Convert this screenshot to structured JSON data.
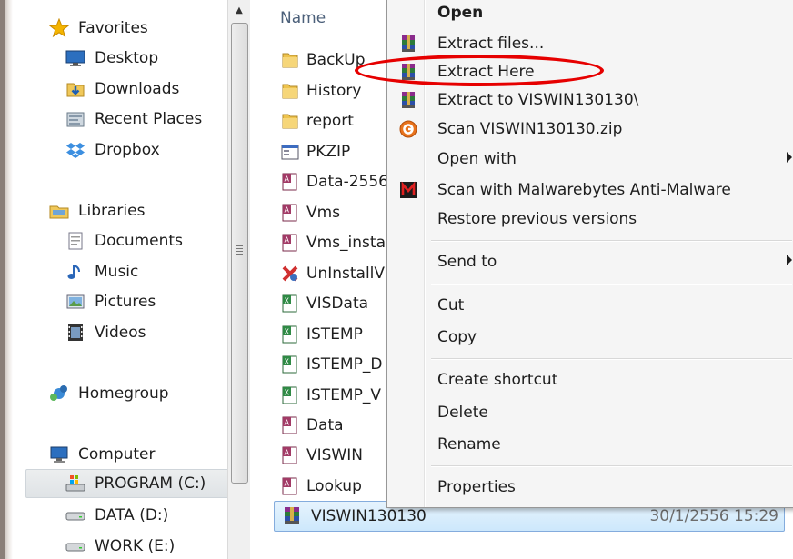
{
  "nav": {
    "favorites": "Favorites",
    "desktop": "Desktop",
    "downloads": "Downloads",
    "recent_places": "Recent Places",
    "dropbox": "Dropbox",
    "libraries": "Libraries",
    "documents": "Documents",
    "music": "Music",
    "pictures": "Pictures",
    "videos": "Videos",
    "homegroup": "Homegroup",
    "computer": "Computer",
    "program_c": "PROGRAM (C:)",
    "data_d": "DATA (D:)",
    "work_e": "WORK (E:)"
  },
  "filelist": {
    "column_name": "Name",
    "rows": [
      "BackUp",
      "History",
      "report",
      "PKZIP",
      "Data-2556",
      "Vms",
      "Vms_insta",
      "UnInstallV",
      "VISData",
      "ISTEMP",
      "ISTEMP_D",
      "ISTEMP_V",
      "Data",
      "VISWIN",
      "Lookup"
    ],
    "selected_name": "VISWIN130130",
    "selected_date": "30/1/2556 15:29"
  },
  "menu": {
    "open": "Open",
    "extract_files": "Extract files...",
    "extract_here": "Extract Here",
    "extract_to": "Extract to VISWIN130130\\",
    "scan_zip": "Scan VISWIN130130.zip",
    "open_with": "Open with",
    "scan_malwarebytes": "Scan with Malwarebytes Anti-Malware",
    "restore_previous": "Restore previous versions",
    "send_to": "Send to",
    "cut": "Cut",
    "copy": "Copy",
    "create_shortcut": "Create shortcut",
    "delete": "Delete",
    "rename": "Rename",
    "properties": "Properties"
  },
  "colors": {
    "highlight_ellipse": "#e60000",
    "selection_border": "#84acdd",
    "menu_background": "#f5f5f5"
  }
}
